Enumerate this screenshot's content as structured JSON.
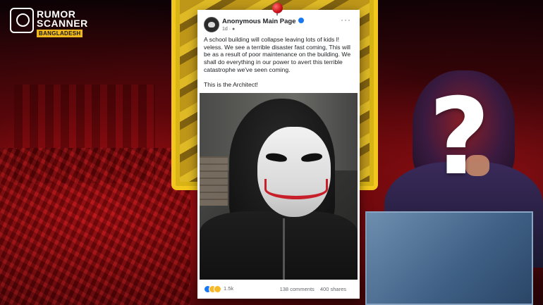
{
  "logo": {
    "line1": "RUMOR",
    "line2": "SCANNER",
    "badge": "BANGLADESH",
    "icon": "phone-check-icon"
  },
  "post": {
    "page_name": "Anonymous Main Page",
    "verified_icon": "verified-badge-icon",
    "time": "1d · ",
    "globe_icon": "globe-icon",
    "more_label": "···",
    "text_paragraph1": "A school building will collapse leaving lots of kids l! veless. We see a terrible disaster fast coming, This will be as a result of poor maintenance on the building. We shall do everything in our power to avert this terrible catastrophe we've seen coming.",
    "text_paragraph2": "This is the Architect!",
    "reaction_count": "1.5k",
    "comments": "138 comments",
    "shares": "400 shares"
  },
  "decor": {
    "question_mark": "?",
    "accent_red": "#c8101a",
    "accent_yellow": "#f2c81e",
    "fb_blue": "#1877f2"
  }
}
